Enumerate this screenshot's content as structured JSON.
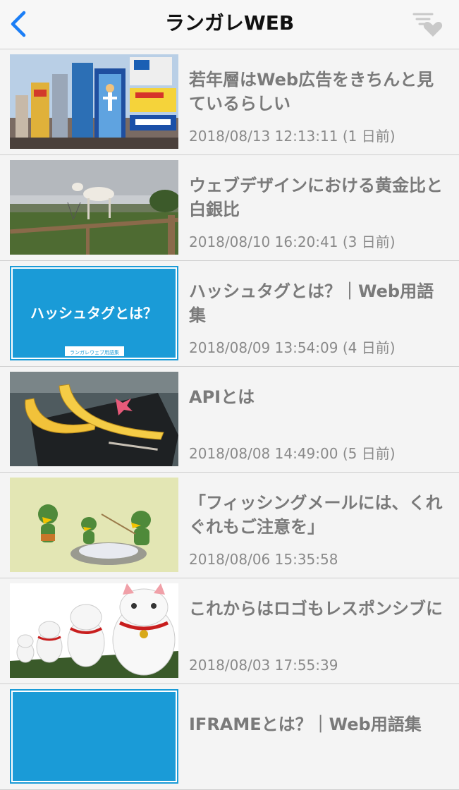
{
  "header": {
    "title": "ランガレWEB",
    "back_icon": "chevron-left-icon",
    "filter_icon": "filter-heart-icon",
    "accent": "#1b7ef6"
  },
  "articles": [
    {
      "title": "若年層はWeb広告をきちんと見ているらしい",
      "date": "2018/08/13 12:13:11 (1 日前)",
      "thumb": "city-billboards-image"
    },
    {
      "title": "ウェブデザインにおける黄金比と白銀比",
      "date": "2018/08/10 16:20:41 (3 日前)",
      "thumb": "goat-on-beam-image"
    },
    {
      "title": "ハッシュタグとは？｜Web用語集",
      "date": "2018/08/09 13:54:09 (4 日前)",
      "thumb": "hashtag-card-image",
      "thumb_text": "ハッシュタグとは？",
      "thumb_caption": "ランガレウェブ用語集"
    },
    {
      "title": "APIとは",
      "date": "2018/08/08 14:49:00 (5 日前)",
      "thumb": "bananas-image"
    },
    {
      "title": "「フィッシングメールには、くれぐれもご注意を」",
      "date": "2018/08/06 15:35:58",
      "thumb": "kappa-figures-image"
    },
    {
      "title": "これからはロゴもレスポンシブに",
      "date": "2018/08/03 17:55:39",
      "thumb": "lucky-cats-image"
    },
    {
      "title": "IFRAMEとは？｜Web用語集",
      "date": "",
      "thumb": "blue-card-image"
    }
  ]
}
